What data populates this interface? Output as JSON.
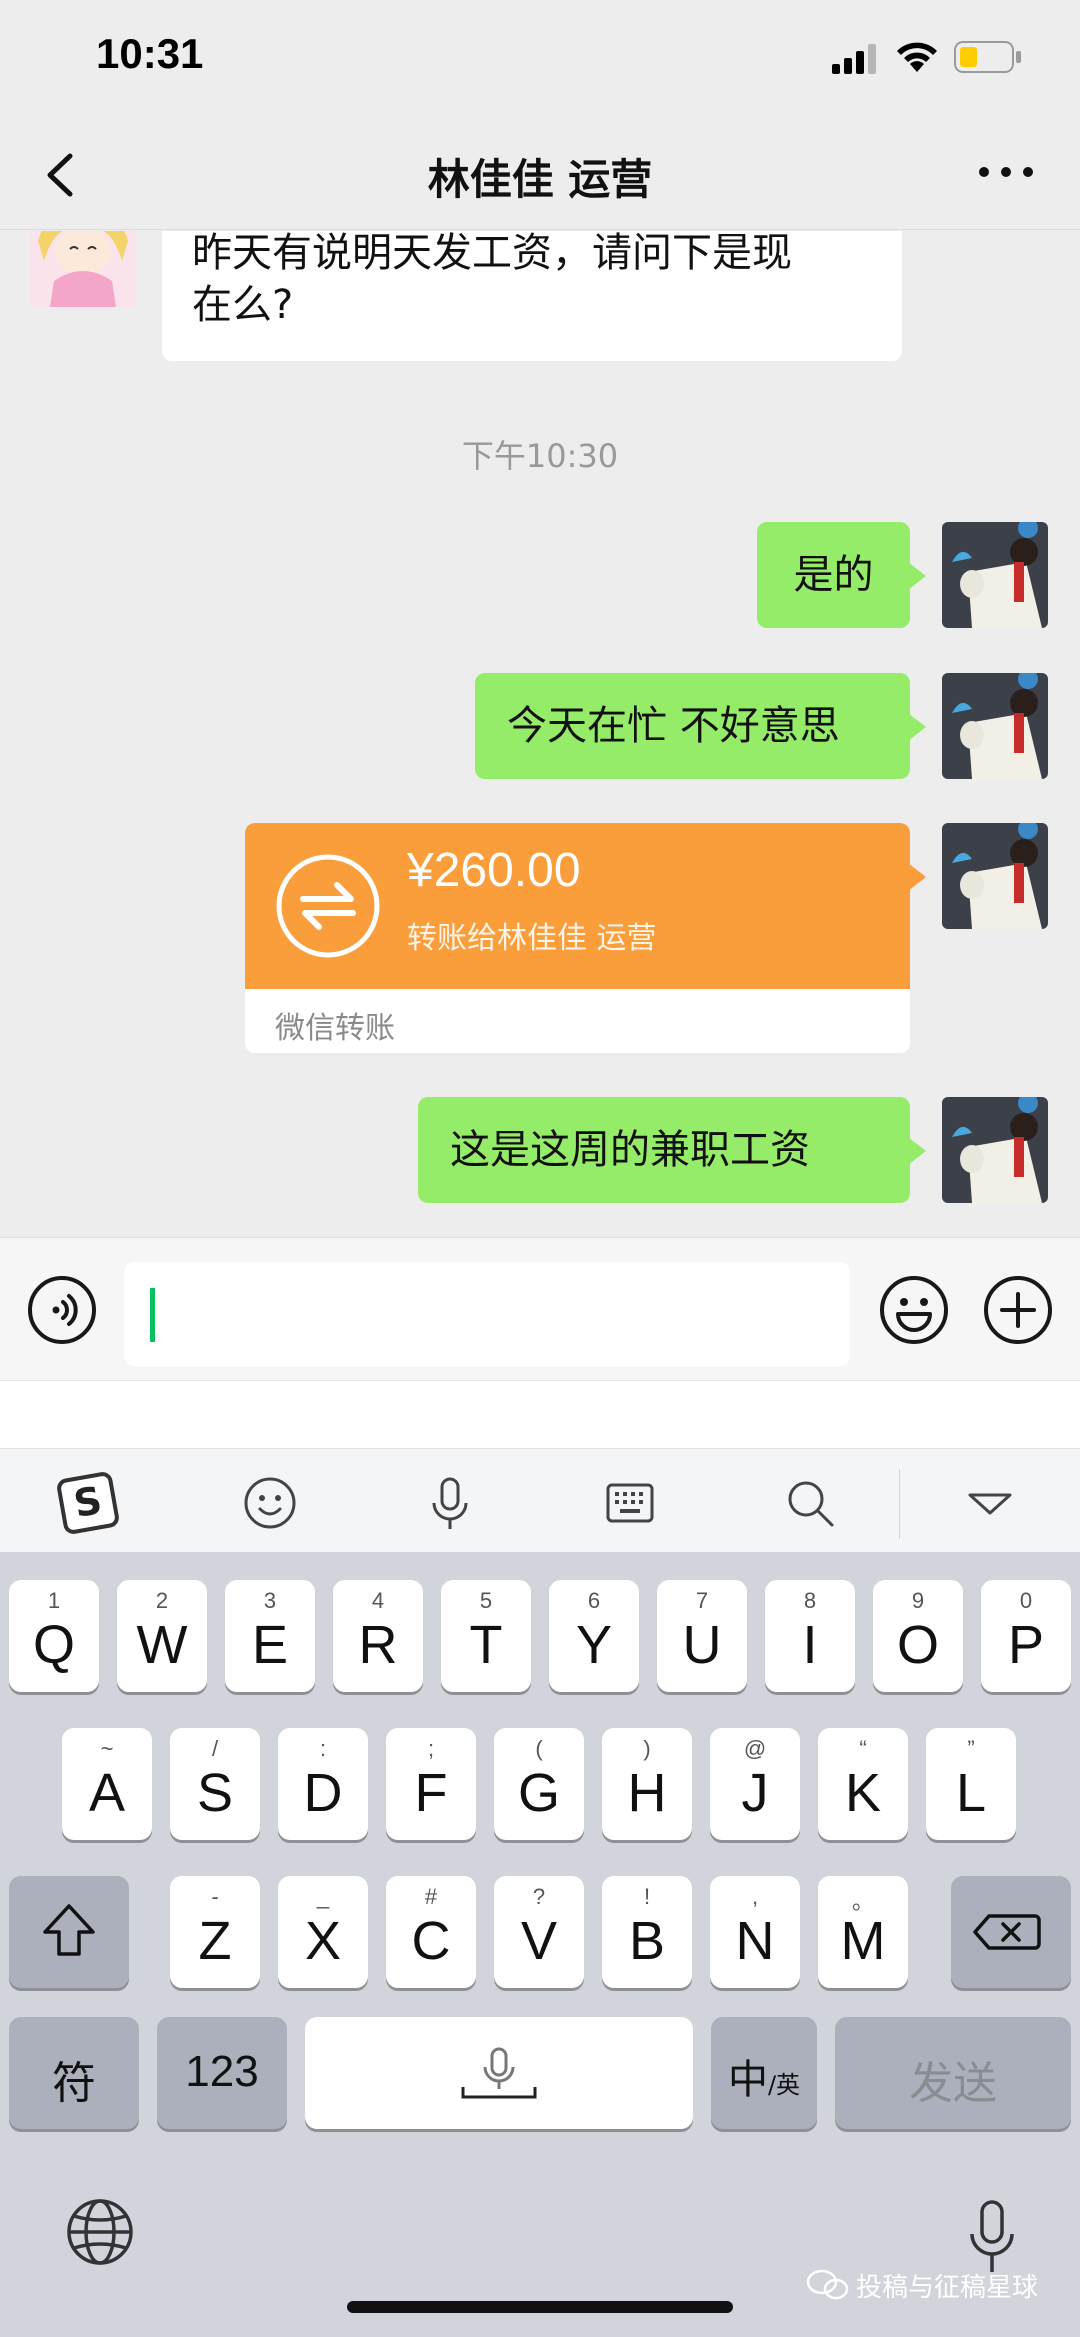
{
  "status_bar": {
    "time": "10:31"
  },
  "nav": {
    "title": "林佳佳 运营"
  },
  "messages": {
    "incoming_1": {
      "line1": "昨天有说明天发工资，请问下是现",
      "line2": "在么?"
    },
    "timestamp": "下午10:30",
    "outgoing_1": "是的",
    "outgoing_2": "今天在忙 不好意思",
    "transfer": {
      "amount": "¥260.00",
      "description": "转账给林佳佳 运营",
      "footer": "微信转账"
    },
    "outgoing_3": "这是这周的兼职工资"
  },
  "keyboard": {
    "row1": [
      {
        "num": "1",
        "letter": "Q"
      },
      {
        "num": "2",
        "letter": "W"
      },
      {
        "num": "3",
        "letter": "E"
      },
      {
        "num": "4",
        "letter": "R"
      },
      {
        "num": "5",
        "letter": "T"
      },
      {
        "num": "6",
        "letter": "Y"
      },
      {
        "num": "7",
        "letter": "U"
      },
      {
        "num": "8",
        "letter": "I"
      },
      {
        "num": "9",
        "letter": "O"
      },
      {
        "num": "0",
        "letter": "P"
      }
    ],
    "row2": [
      {
        "hint": "~",
        "letter": "A"
      },
      {
        "hint": "/",
        "letter": "S"
      },
      {
        "hint": ":",
        "letter": "D"
      },
      {
        "hint": ";",
        "letter": "F"
      },
      {
        "hint": "(",
        "letter": "G"
      },
      {
        "hint": ")",
        "letter": "H"
      },
      {
        "hint": "@",
        "letter": "J"
      },
      {
        "hint": "“",
        "letter": "K"
      },
      {
        "hint": "”",
        "letter": "L"
      }
    ],
    "row3": [
      {
        "hint": "-",
        "letter": "Z"
      },
      {
        "hint": "_",
        "letter": "X"
      },
      {
        "hint": "#",
        "letter": "C"
      },
      {
        "hint": "?",
        "letter": "V"
      },
      {
        "hint": "!",
        "letter": "B"
      },
      {
        "hint": ",",
        "letter": "N"
      },
      {
        "hint": "。",
        "letter": "M"
      }
    ],
    "symbols_label": "符",
    "numbers_label": "123",
    "lang_label_main": "中",
    "lang_label_sub": "/英",
    "send_label": "发送"
  },
  "watermark": "投稿与征稿星球",
  "colors": {
    "outgoing_bubble": "#95ec69",
    "transfer": "#fa9d3b",
    "caret": "#07c160"
  }
}
